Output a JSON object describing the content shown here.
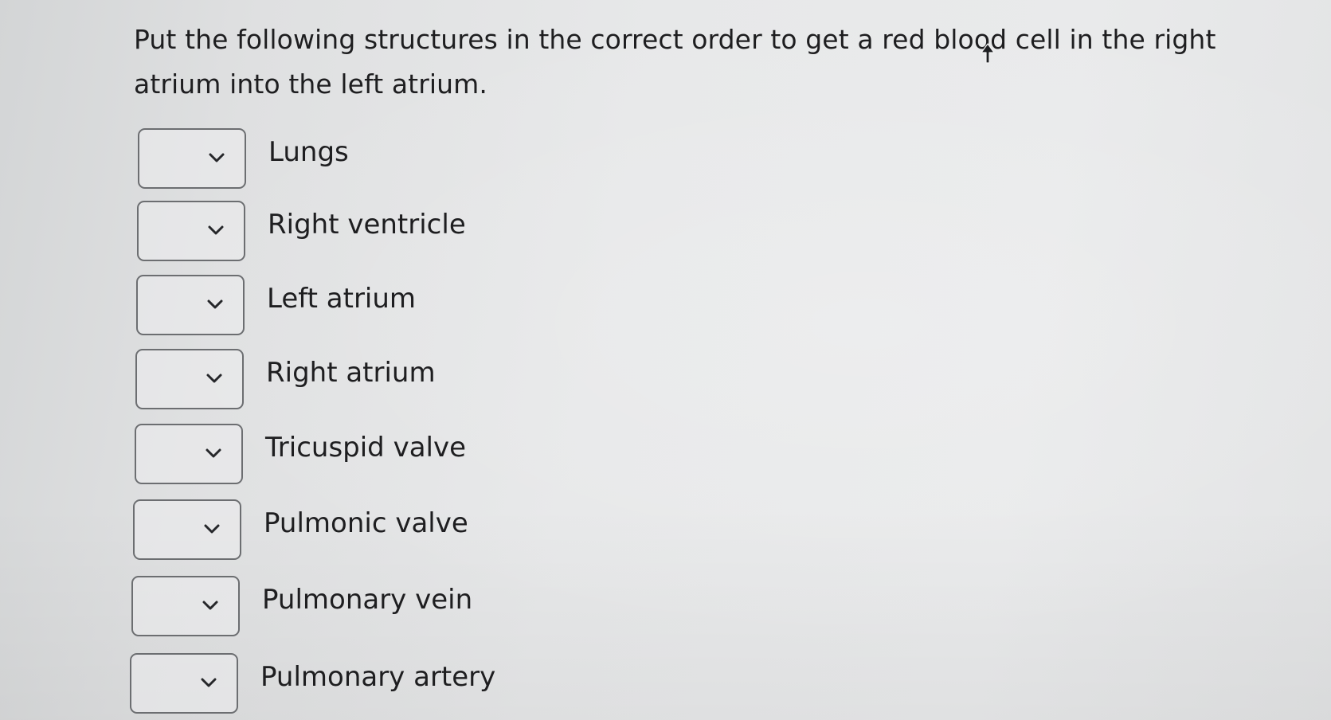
{
  "question": {
    "text": "Put the following structures in the correct order to get a red blood cell in the right atrium into the left atrium."
  },
  "items": [
    {
      "label": "Lungs",
      "selected": ""
    },
    {
      "label": "Right ventricle",
      "selected": ""
    },
    {
      "label": "Left atrium",
      "selected": ""
    },
    {
      "label": "Right atrium",
      "selected": ""
    },
    {
      "label": "Tricuspid valve",
      "selected": ""
    },
    {
      "label": "Pulmonic valve",
      "selected": ""
    },
    {
      "label": "Pulmonary vein",
      "selected": ""
    },
    {
      "label": "Pulmonary artery",
      "selected": ""
    }
  ],
  "icons": {
    "dropdown": "chevron-down-icon",
    "cursor": "mouse-pointer-icon"
  },
  "colors": {
    "text": "#1e1e20",
    "border": "#6c6e71",
    "background": "#e7e8e9"
  }
}
